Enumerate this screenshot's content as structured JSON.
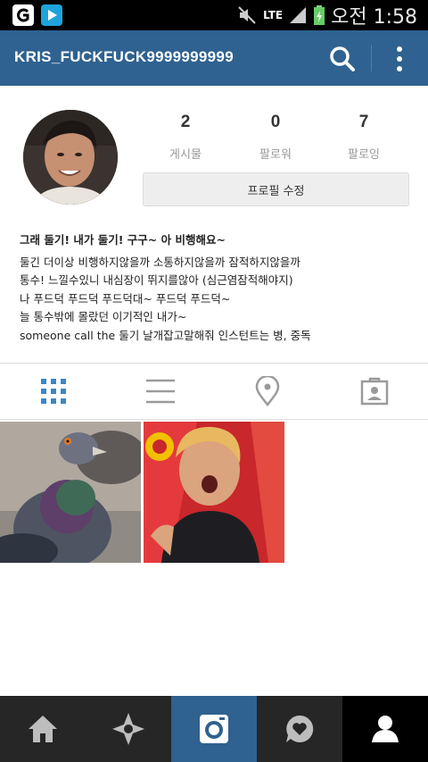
{
  "status_bar": {
    "network": "LTE",
    "time": "오전 1:58"
  },
  "header": {
    "username": "KRIS_FUCKFUCK9999999999",
    "icons": [
      "search-icon",
      "more-vert-icon"
    ]
  },
  "profile": {
    "stats": [
      {
        "value": "2",
        "label": "게시물"
      },
      {
        "value": "0",
        "label": "팔로워"
      },
      {
        "value": "7",
        "label": "팔로잉"
      }
    ],
    "edit_button": "프로필 수정"
  },
  "bio": {
    "name_line": "그래 둘기! 내가 둘기! 구구~ 아 비행해요~",
    "lines": [
      "둘긴 더이상 비행하지않을까 소통하지않을까 잠적하지않을까",
      "통수! 느낄수있니 내심장이 뛰지를않아 (심근염잠적해야지)",
      "나 푸드덕 푸드덕 푸드덕대~ 푸드덕 푸드덕~",
      "늘 통수밖에 몰랐던 이기적인 내가~",
      "someone call the 둘기 날개잡고말해줘 인스턴트는 병, 중독"
    ]
  },
  "tabs": [
    "grid-icon",
    "list-icon",
    "location-icon",
    "tagged-icon"
  ],
  "colors": {
    "appbar": "#2f6290",
    "active_tab": "#3b87c6",
    "bottom_nav": "#262626",
    "camera_tab": "#2f6290"
  },
  "bottom_nav": [
    "home-icon",
    "explore-icon",
    "camera-icon",
    "activity-icon",
    "profile-icon"
  ]
}
